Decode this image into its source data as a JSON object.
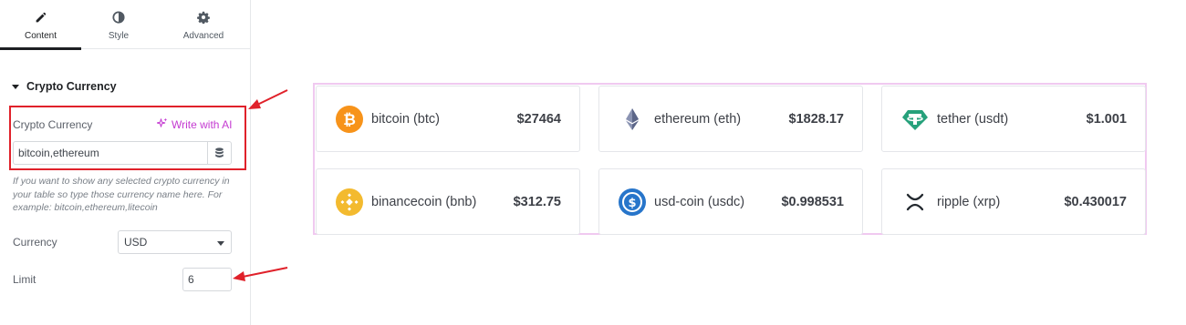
{
  "tabs": [
    {
      "label": "Content",
      "icon": "pencil-icon"
    },
    {
      "label": "Style",
      "icon": "half-circle-icon"
    },
    {
      "label": "Advanced",
      "icon": "gear-icon"
    }
  ],
  "section": {
    "title": "Crypto Currency"
  },
  "crypto_field": {
    "label": "Crypto Currency",
    "ai_label": "Write with AI",
    "value": "bitcoin,ethereum",
    "help": "If you want to show any selected crypto currency in your table so type those currency name here. For example: bitcoin,ethereum,litecoin"
  },
  "currency_field": {
    "label": "Currency",
    "value": "USD"
  },
  "limit_field": {
    "label": "Limit",
    "value": "6"
  },
  "annotations": {
    "color": "#e0212a"
  },
  "coins": [
    {
      "name": "bitcoin (btc)",
      "price": "$27464",
      "icon": "bitcoin-icon",
      "color": "#f7931a"
    },
    {
      "name": "ethereum (eth)",
      "price": "$1828.17",
      "icon": "ethereum-icon",
      "color": "#6b7a99"
    },
    {
      "name": "tether (usdt)",
      "price": "$1.001",
      "icon": "tether-icon",
      "color": "#26a17b"
    },
    {
      "name": "binancecoin (bnb)",
      "price": "$312.75",
      "icon": "bnb-icon",
      "color": "#f3ba2f"
    },
    {
      "name": "usd-coin (usdc)",
      "price": "$0.998531",
      "icon": "usdc-icon",
      "color": "#2775ca"
    },
    {
      "name": "ripple (xrp)",
      "price": "$0.430017",
      "icon": "xrp-icon",
      "color": "#23292f"
    }
  ]
}
